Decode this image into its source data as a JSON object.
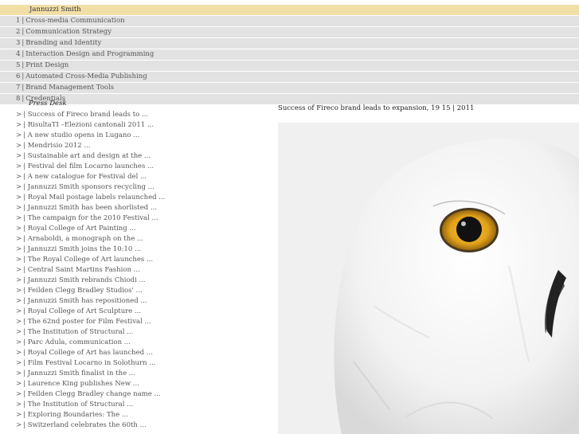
{
  "site": {
    "active_label": "Jannuzzi Smith"
  },
  "nav": [
    {
      "num": "1",
      "label": "Cross-media Communication"
    },
    {
      "num": "2",
      "label": "Communication Strategy"
    },
    {
      "num": "3",
      "label": "Branding and Identity"
    },
    {
      "num": "4",
      "label": "Interaction Design and Programming"
    },
    {
      "num": "5",
      "label": "Print Design"
    },
    {
      "num": "6",
      "label": "Automated Cross-Media Publishing"
    },
    {
      "num": "7",
      "label": "Brand Management Tools"
    },
    {
      "num": "8",
      "label": "Credentials"
    }
  ],
  "press": {
    "heading": "Press Desk",
    "marker": ">",
    "items": [
      "Success of Fireco brand leads to ...",
      "RisultaTI –Elezioni cantonali 2011 ...",
      "A new studio opens in Lugano ...",
      "Mendrisio 2012 ...",
      "Sustainable art and design at the ...",
      "Festival del film Locarno launches ...",
      "A new catalogue for Festival del ...",
      "Jannuzzi Smith sponsors recycling ...",
      "Royal Mail postage labels relaunched ...",
      "Jannuzzi Smith has been shorlisted ...",
      "The campaign for the 2010 Festival ...",
      "Royal College of Art Painting ...",
      "Arnaboldi, a monograph on the ...",
      "Jannuzzi Smith joins the 10:10 ...",
      "The Royal College of Art launches ...",
      "Central Saint Martins Fashion ...",
      "Jannuzzi Smith rebrands Chiodi ...",
      "Feilden Clegg Bradley Studios' ...",
      "Jannuzzi Smith has repositioned ...",
      "Royal College of Art Sculpture ...",
      "The 62nd poster for Film Festival ...",
      "The Institution of Structural ...",
      "Parc Adula, communication ...",
      "Royal College of Art has launched ...",
      "Film Festival Locarno in Solothurn ...",
      "Jannuzzi Smith finalist in the ...",
      "Laurence King publishes New ...",
      "Feilden Clegg Bradley change name ...",
      "The Institution of Structural ...",
      "Exploring Boundaries: The ...",
      "Switzerland celebrates the 60th ..."
    ]
  },
  "article": {
    "headline": "Success of Fireco brand leads to expansion,  19 15 | 2011"
  },
  "colors": {
    "active_row": "#f6e6b8",
    "nav_row": "#e9e9e9",
    "owl_eye": "#e0a020"
  }
}
